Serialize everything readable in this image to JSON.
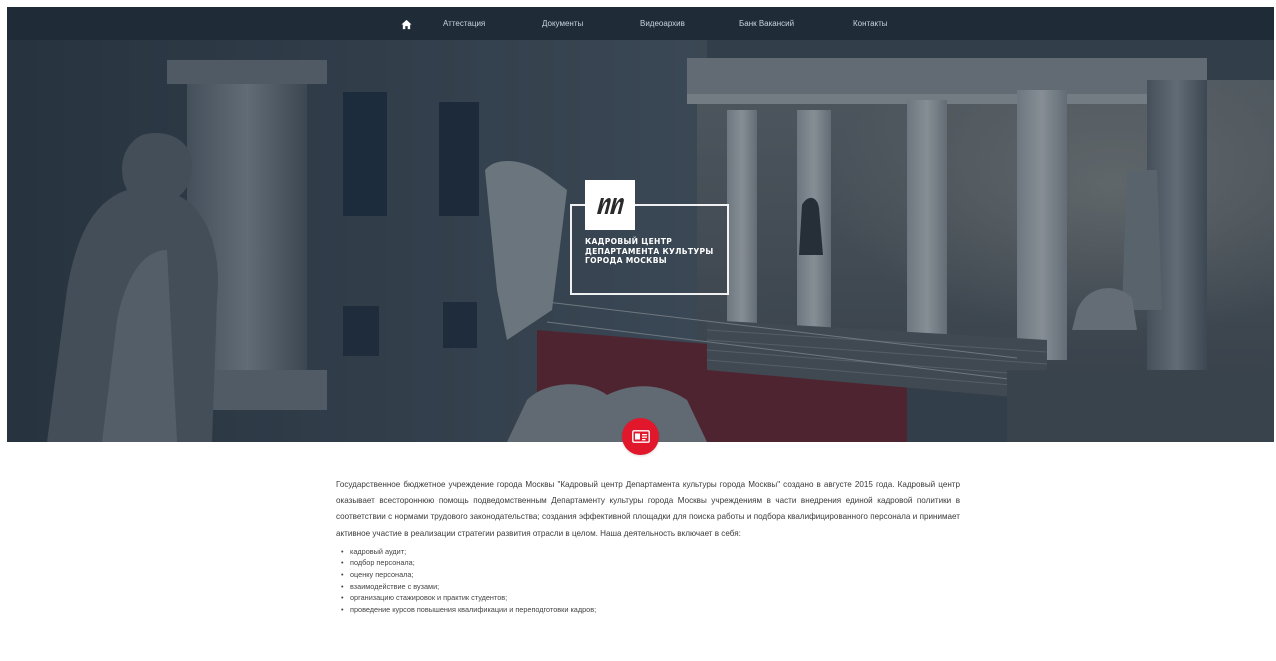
{
  "nav": {
    "home_icon": "home-icon",
    "items": [
      {
        "label": "Аттестация"
      },
      {
        "label": "Документы"
      },
      {
        "label": "Видеоархив"
      },
      {
        "label": "Банк Вакансий"
      },
      {
        "label": "Контакты"
      }
    ]
  },
  "hero": {
    "logo_lines": [
      "КАДРОВЫЙ ЦЕНТР",
      "ДЕПАРТАМЕНТА КУЛЬТУРЫ",
      "ГОРОДА МОСКВЫ"
    ],
    "badge_icon": "id-card-icon"
  },
  "colors": {
    "nav_bg": "#1f2c38",
    "accent": "#e1182b"
  },
  "content": {
    "intro": "Государственное бюджетное учреждение города Москвы \"Кадровый центр Департамента культуры города Москвы\" создано в августе 2015 года. Кадровый центр оказывает всестороннюю помощь подведомственным Департаменту культуры города Москвы учреждениям в части внедрения единой кадровой политики в соответствии с нормами трудового законодательства; создания эффективной площадки для поиска работы и подбора квалифицированного персонала и принимает активное участие в реализации стратегии развития отрасли в целом. Наша деятельность включает в себя:",
    "activities": [
      "кадровый аудит;",
      "подбор персонала;",
      "оценку персонала;",
      "взаимодействие с вузами;",
      "организацию стажировок и практик студентов;",
      "проведение курсов повышения квалификации и переподготовки кадров;"
    ]
  }
}
